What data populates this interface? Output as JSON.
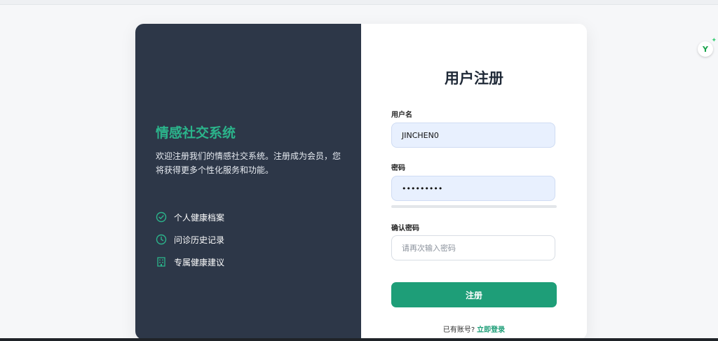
{
  "left_panel": {
    "brand": "情感社交系统",
    "welcome": "欢迎注册我们的情感社交系统。注册成为会员，您将获得更多个性化服务和功能。",
    "features": [
      {
        "icon": "check-circle-icon",
        "label": "个人健康档案"
      },
      {
        "icon": "clock-icon",
        "label": "问诊历史记录"
      },
      {
        "icon": "building-icon",
        "label": "专属健康建议"
      }
    ]
  },
  "form": {
    "title": "用户注册",
    "username_label": "用户名",
    "username_value": "JINCHEN0",
    "password_label": "密码",
    "password_value": "•••••••••",
    "confirm_label": "确认密码",
    "confirm_placeholder": "请再次输入密码",
    "submit_label": "注册",
    "have_account": "已有账号?",
    "login_link": "立即登录"
  },
  "extension_icon": {
    "letter": "Y",
    "spark": "✦"
  },
  "colors": {
    "accent": "#1e9e78",
    "panel": "#2d3748",
    "brand_text": "#2bb48b"
  }
}
